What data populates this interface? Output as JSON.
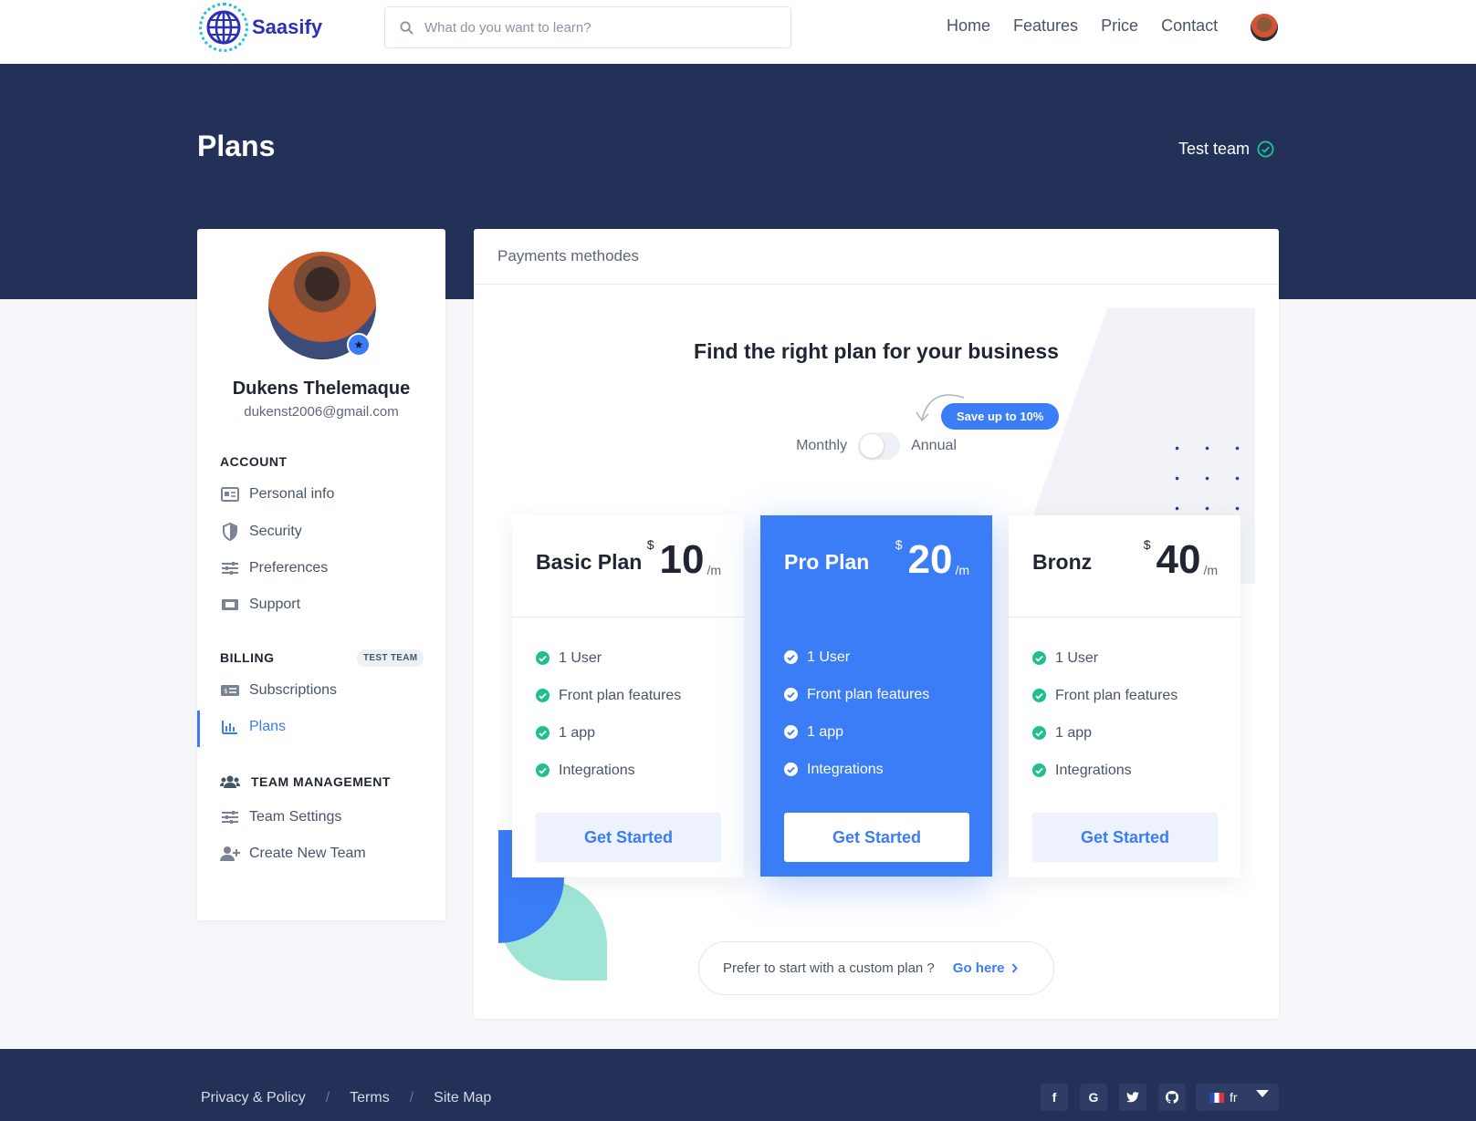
{
  "brand": {
    "name": "Saasify"
  },
  "search": {
    "placeholder": "What do you want to learn?"
  },
  "nav": {
    "links": [
      "Home",
      "Features",
      "Price",
      "Contact"
    ]
  },
  "page": {
    "title": "Plans",
    "team": "Test team"
  },
  "profile": {
    "name": "Dukens Thelemaque",
    "email": "dukenst2006@gmail.com"
  },
  "sidebar": {
    "account_heading": "ACCOUNT",
    "account_items": [
      "Personal info",
      "Security",
      "Preferences",
      "Support"
    ],
    "billing_heading": "BILLING",
    "billing_badge": "TEST TEAM",
    "billing_items": [
      "Subscriptions",
      "Plans"
    ],
    "team_heading": "TEAM MANAGEMENT",
    "team_items": [
      "Team Settings",
      "Create New Team"
    ],
    "active_item": "Plans"
  },
  "main": {
    "header": "Payments methodes",
    "headline": "Find the right plan for your business",
    "save_badge": "Save up to 10%",
    "toggle": {
      "left": "Monthly",
      "right": "Annual",
      "annual_selected": false
    },
    "plans": [
      {
        "name": "Basic Plan",
        "currency": "$",
        "price": "10",
        "period": "/m",
        "features": [
          "1 User",
          "Front plan features",
          "1 app",
          "Integrations"
        ],
        "cta": "Get Started"
      },
      {
        "name": "Pro Plan",
        "currency": "$",
        "price": "20",
        "period": "/m",
        "features": [
          "1 User",
          "Front plan features",
          "1 app",
          "Integrations"
        ],
        "cta": "Get Started"
      },
      {
        "name": "Bronz",
        "currency": "$",
        "price": "40",
        "period": "/m",
        "features": [
          "1 User",
          "Front plan features",
          "1 app",
          "Integrations"
        ],
        "cta": "Get Started"
      }
    ],
    "custom_plan": {
      "text": "Prefer to start with a custom plan ?",
      "link": "Go here"
    }
  },
  "footer": {
    "links": [
      "Privacy & Policy",
      "Terms",
      "Site Map"
    ],
    "separator": "/",
    "socials": [
      "facebook-icon",
      "google-icon",
      "twitter-icon",
      "github-icon"
    ],
    "language": "fr"
  },
  "colors": {
    "primary": "#3b7cf7",
    "navy": "#233159",
    "success": "#1fbf8f"
  }
}
